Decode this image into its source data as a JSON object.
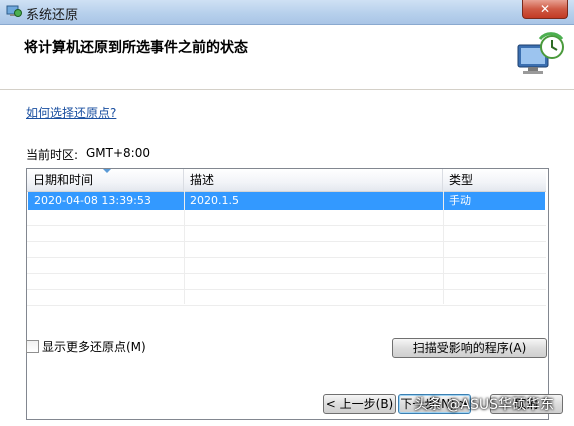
{
  "window": {
    "title": "系统还原",
    "close_label": "✕"
  },
  "header": {
    "heading": "将计算机还原到所选事件之前的状态"
  },
  "help_link": "如何选择还原点?",
  "timezone": {
    "label": "当前时区:",
    "value": "GMT+8:00"
  },
  "table": {
    "columns": [
      "日期和时间",
      "描述",
      "类型"
    ],
    "rows": [
      {
        "datetime": "2020-04-08 13:39:53",
        "description": "2020.1.5",
        "type": "手动",
        "selected": true
      }
    ]
  },
  "show_more": {
    "label": "显示更多还原点(M)",
    "checked": false
  },
  "scan_button": "扫描受影响的程序(A)",
  "footer": {
    "back": "< 上一步(B)",
    "next": "下一步(N) >",
    "cancel": "取消"
  },
  "watermark": "头条 @ASUS华硕华东",
  "colors": {
    "selection": "#3399ff",
    "link": "#1a4fa0"
  },
  "icons": [
    "app-restore-icon",
    "system-restore-icon",
    "sort-ascending-icon",
    "close-icon"
  ]
}
